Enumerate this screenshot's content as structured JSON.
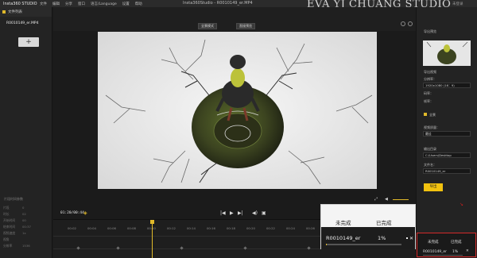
{
  "titlebar": {
    "app_name": "Insta360 STUDIO",
    "menu": [
      "文件",
      "编辑",
      "分享",
      "窗口",
      "语言/Language",
      "设置",
      "帮助"
    ],
    "window_title": "Insta360Studio - R0010149_er.MP4",
    "watermark": "EVA YJ CHUANG STUDIO",
    "user": "未登录"
  },
  "left_panel": {
    "title": "文件列表",
    "file": "R0010149_er.MP4",
    "add_label": "+",
    "params_title": "片段时间参数",
    "params": [
      {
        "label": "片段",
        "value": "0"
      },
      {
        "label": "时长",
        "value": "02"
      },
      {
        "label": "开始时间",
        "value": "00"
      },
      {
        "label": "结束时间",
        "value": "00:37"
      },
      {
        "label": "视频速度",
        "value": "1x"
      },
      {
        "label": "视角",
        "value": ""
      },
      {
        "label": "分辨率",
        "value": "1536"
      }
    ]
  },
  "preview_toolbar": {
    "btn_normal": "全景模式",
    "btn_planet": "直接预览"
  },
  "controls": {
    "timecode": "01:20/00:44",
    "ruler": [
      "00:02",
      "00:04",
      "00:06",
      "00:08",
      "00:10",
      "00:12",
      "00:14",
      "00:16",
      "00:18",
      "00:20",
      "00:22",
      "00:24",
      "00:26",
      "00:28",
      "00:30",
      "00:32"
    ]
  },
  "right_panel": {
    "section": "导出视频",
    "thumb_title": "导出预览",
    "resolution_label": "分辨率：",
    "resolution_value": "1920x1080 (16：9)",
    "bitrate_label": "码率：",
    "bitrate_value": "",
    "fps_label": "帧率：",
    "check_label": "全景",
    "quality_label": "视频质量：",
    "quality_value": "最佳",
    "output_label": "输出目录",
    "output_value": "C:\\Users\\Desktop",
    "filename_label": "文件名：",
    "filename_value": "R0010149_er",
    "export_btn": "导出"
  },
  "export_popup": {
    "tab_pending": "未完成",
    "tab_done": "已完成",
    "file": "R0010149_er",
    "percent": "1%",
    "progress": 0.01
  },
  "mini_queue": {
    "tab_pending": "未完成",
    "tab_done": "已完成",
    "file": "R0010149_er",
    "percent": "1%"
  },
  "colors": {
    "accent": "#e0b92a",
    "export_button": "#f2c20f",
    "highlight_border": "#d42a2a"
  }
}
